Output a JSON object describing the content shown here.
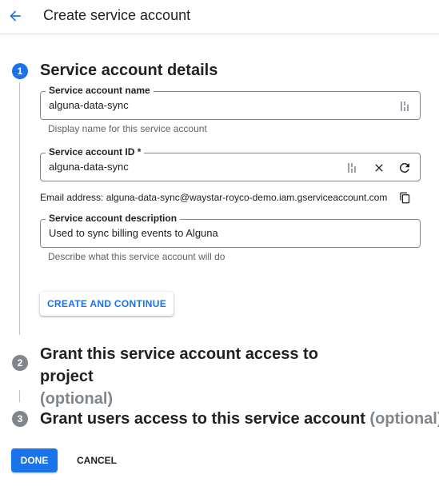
{
  "header": {
    "back_icon": "arrow-back-icon",
    "title": "Create service account"
  },
  "steps": [
    {
      "number": "1",
      "title": "Service account details",
      "optional": "",
      "state": "active"
    },
    {
      "number": "2",
      "title": "Grant this service account access to project",
      "optional": "(optional)",
      "state": "inactive"
    },
    {
      "number": "3",
      "title": "Grant users access to this service account",
      "optional": "(optional)",
      "state": "inactive"
    }
  ],
  "form": {
    "name": {
      "label": "Service account name",
      "value": "alguna-data-sync",
      "hint": "Display name for this service account"
    },
    "id": {
      "label": "Service account ID *",
      "value": "alguna-data-sync"
    },
    "email": {
      "text": "Email address: alguna-data-sync@waystar-royco-demo.iam.gserviceaccount.com"
    },
    "description": {
      "label": "Service account description",
      "value": "Used to sync billing events to Alguna",
      "hint": "Describe what this service account will do"
    }
  },
  "buttons": {
    "create_continue": "CREATE AND CONTINUE",
    "done": "DONE",
    "cancel": "CANCEL"
  },
  "colors": {
    "accent": "#1a73e8",
    "inactive_step": "#80868b",
    "hint_text": "#5f6368"
  }
}
